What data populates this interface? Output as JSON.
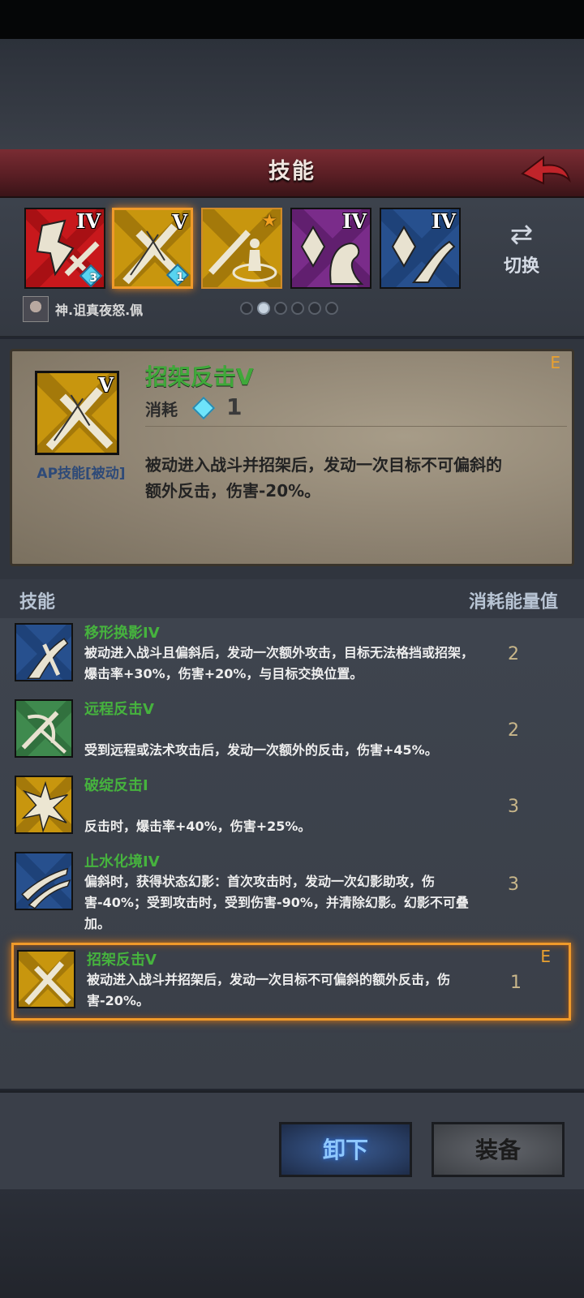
{
  "header": {
    "title": "技能"
  },
  "slots": [
    {
      "rank": "IV",
      "theme": "red",
      "gem_count": "3"
    },
    {
      "rank": "V",
      "theme": "gold",
      "gem_count": "1",
      "selected": true
    },
    {
      "rank": "",
      "theme": "gold",
      "starred": true
    },
    {
      "rank": "IV",
      "theme": "purple"
    },
    {
      "rank": "IV",
      "theme": "blue"
    }
  ],
  "switch": {
    "label": "切换"
  },
  "character": {
    "name": "神.诅真夜怒.佩"
  },
  "pagination": {
    "count": 6,
    "current": 2
  },
  "detail": {
    "rank_letter": "E",
    "icon_rank": "V",
    "name": "招架反击V",
    "cost_label": "消耗",
    "cost_value": "1",
    "type": "AP技能[被动]",
    "description": "被动进入战斗并招架后，发动一次目标不可偏斜的额外反击，伤害-20%。"
  },
  "list_header": {
    "left": "技能",
    "right": "消耗能量值"
  },
  "skills": [
    {
      "name": "移形换影IV",
      "description": "被动进入战斗且偏斜后，发动一次额外攻击，目标无法格挡或招架，爆击率+30%，伤害+20%，与目标交换位置。",
      "cost": "2",
      "theme": "blue"
    },
    {
      "name": "远程反击V",
      "description": "受到远程或法术攻击后，发动一次额外的反击，伤害+45%。",
      "cost": "2",
      "theme": "green"
    },
    {
      "name": "破绽反击I",
      "description": "反击时，爆击率+40%，伤害+25%。",
      "cost": "3",
      "theme": "gold"
    },
    {
      "name": "止水化境IV",
      "description": "偏斜时，获得状态幻影：首次攻击时，发动一次幻影助攻，伤害-40%；受到攻击时，受到伤害-90%，并清除幻影。幻影不可叠加。",
      "cost": "3",
      "theme": "blue"
    },
    {
      "name": "招架反击V",
      "description": "被动进入战斗并招架后，发动一次目标不可偏斜的额外反击，伤害-20%。",
      "cost": "1",
      "theme": "gold",
      "rank": "E",
      "selected": true
    }
  ],
  "buttons": {
    "unequip": "卸下",
    "equip": "装备"
  },
  "colors": {
    "accent_orange": "#f09a2a",
    "skill_name_green": "#46b33e",
    "header_red": "#6a2429"
  }
}
